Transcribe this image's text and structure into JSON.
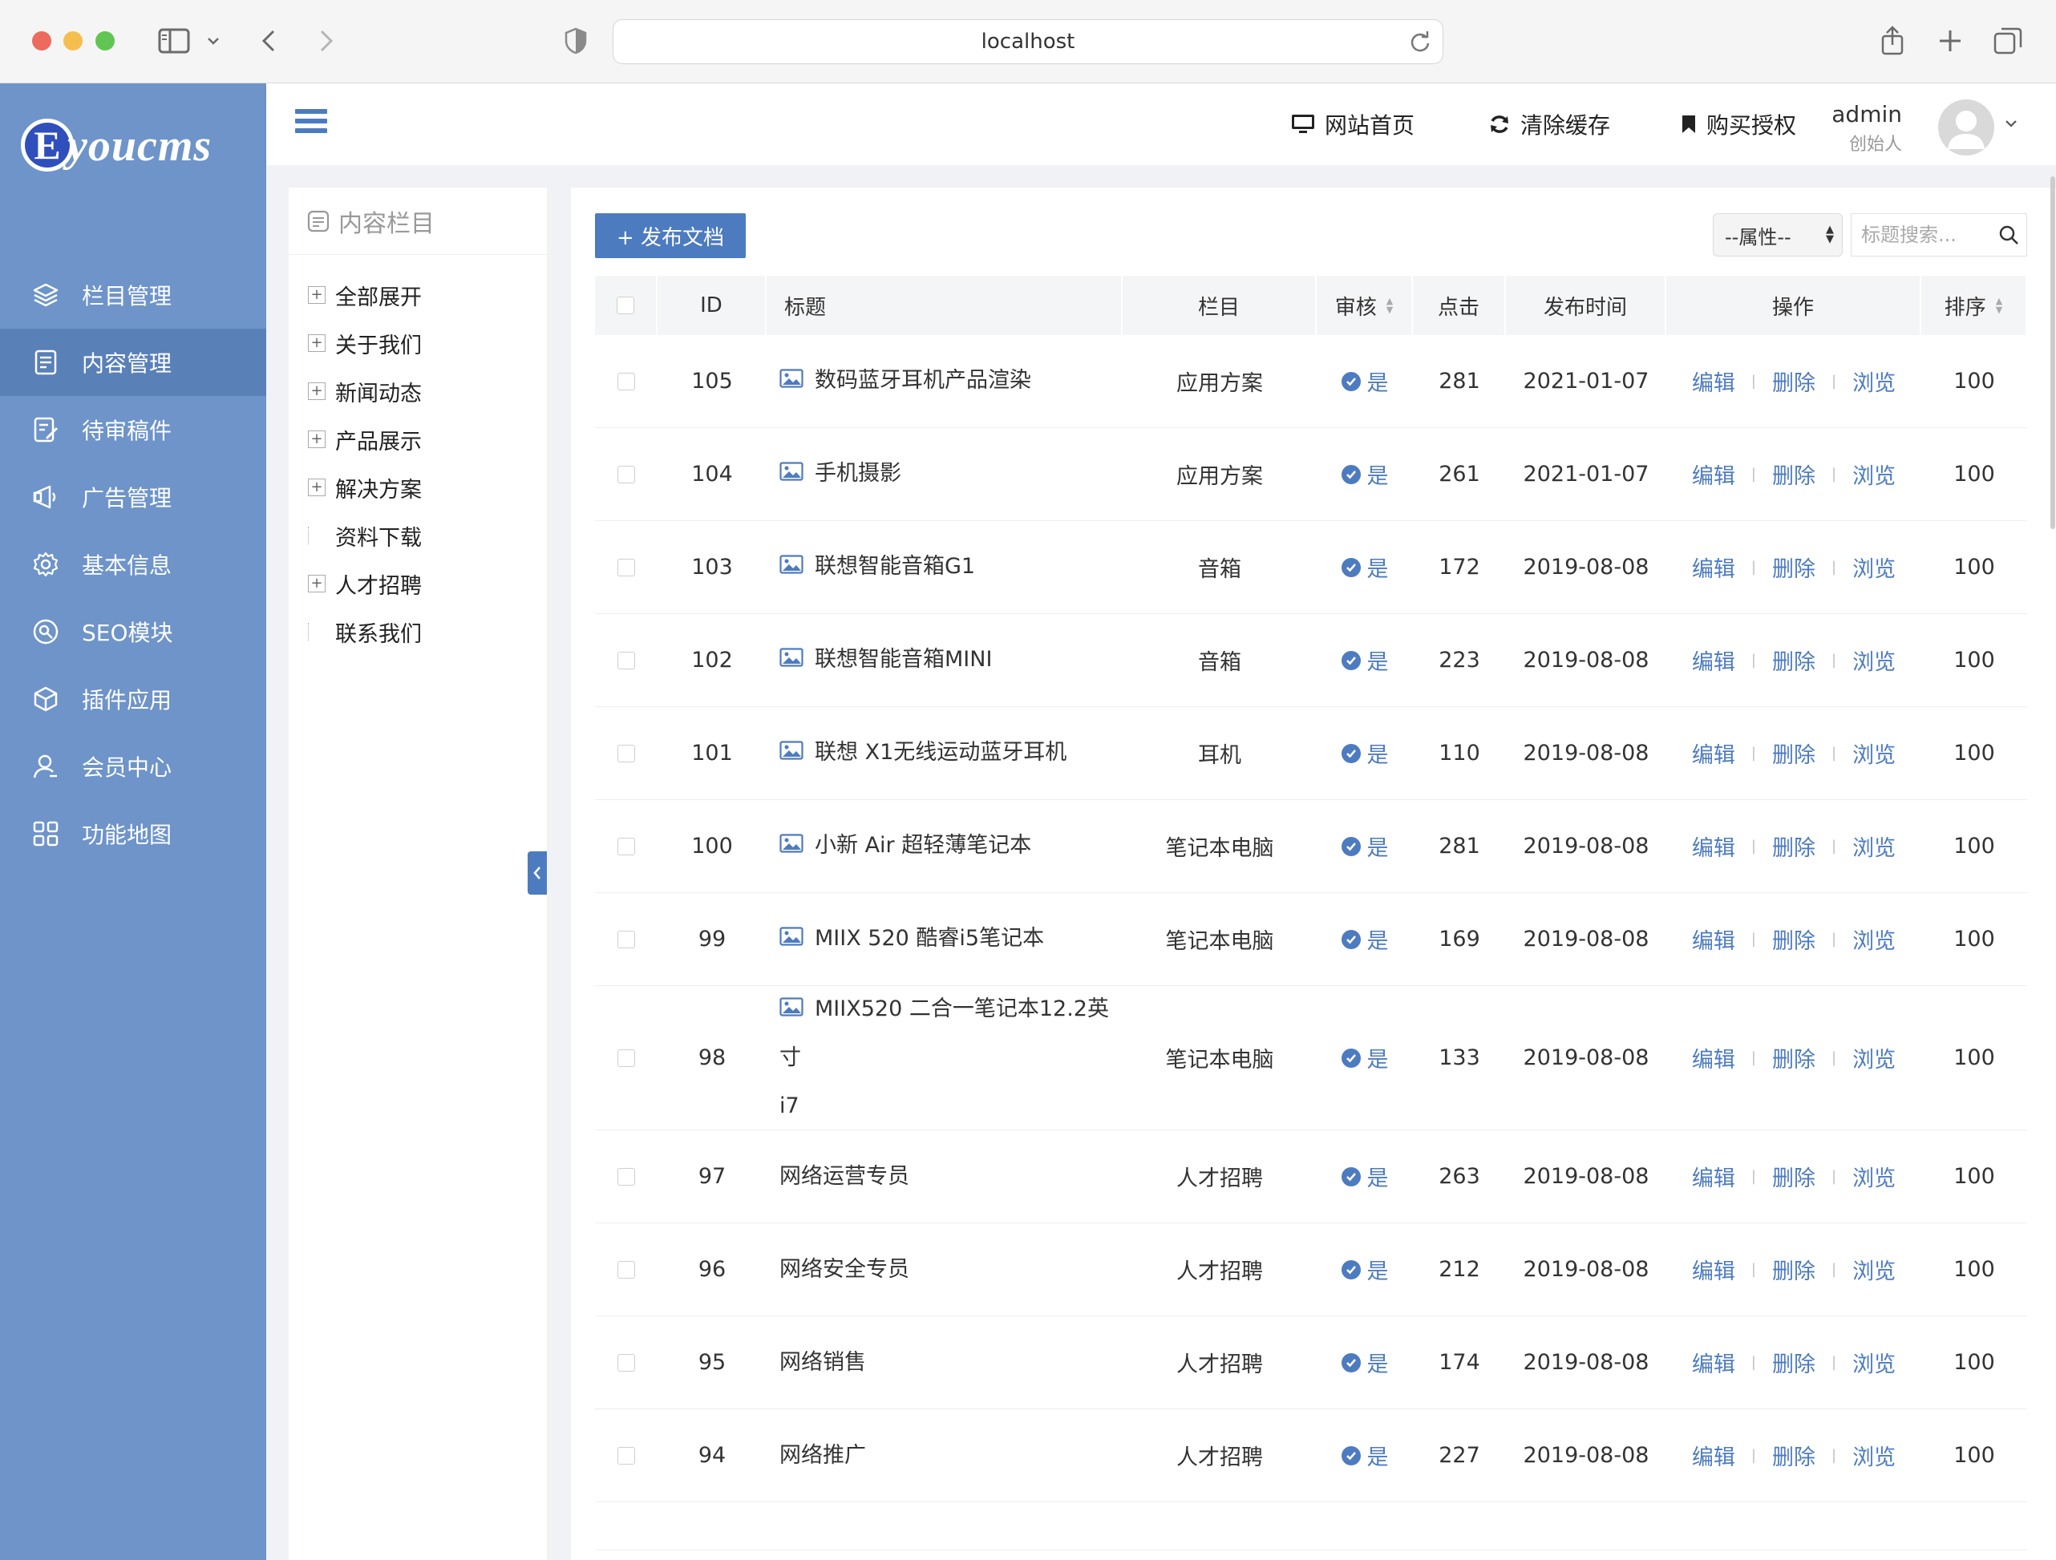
{
  "browser": {
    "url": "localhost"
  },
  "sidebar": {
    "logo_letter": "E",
    "logo_text": "youcms",
    "items": [
      {
        "label": "栏目管理",
        "icon": "layers-icon",
        "active": false
      },
      {
        "label": "内容管理",
        "icon": "document-icon",
        "active": true
      },
      {
        "label": "待审稿件",
        "icon": "edit-doc-icon",
        "active": false
      },
      {
        "label": "广告管理",
        "icon": "ad-icon",
        "active": false
      },
      {
        "label": "基本信息",
        "icon": "gear-icon",
        "active": false
      },
      {
        "label": "SEO模块",
        "icon": "seo-icon",
        "active": false
      },
      {
        "label": "插件应用",
        "icon": "cube-icon",
        "active": false
      },
      {
        "label": "会员中心",
        "icon": "user-icon",
        "active": false
      },
      {
        "label": "功能地图",
        "icon": "grid-icon",
        "active": false
      }
    ]
  },
  "header": {
    "links": [
      {
        "label": "网站首页",
        "icon": "monitor-icon"
      },
      {
        "label": "清除缓存",
        "icon": "refresh-icon"
      },
      {
        "label": "购买授权",
        "icon": "bookmark-icon"
      }
    ],
    "user_name": "admin",
    "user_role": "创始人"
  },
  "tree": {
    "title": "内容栏目",
    "items": [
      {
        "label": "全部展开",
        "toggle": "+"
      },
      {
        "label": "关于我们",
        "toggle": "+"
      },
      {
        "label": "新闻动态",
        "toggle": "+"
      },
      {
        "label": "产品展示",
        "toggle": "+"
      },
      {
        "label": "解决方案",
        "toggle": "+"
      },
      {
        "label": "资料下载",
        "toggle": ""
      },
      {
        "label": "人才招聘",
        "toggle": "+"
      },
      {
        "label": "联系我们",
        "toggle": ""
      }
    ]
  },
  "toolbar": {
    "publish_label": "+ 发布文档",
    "attr_select_value": "--属性--",
    "search_placeholder": "标题搜索..."
  },
  "table": {
    "headers": {
      "id": "ID",
      "title": "标题",
      "column": "栏目",
      "audit": "审核",
      "hits": "点击",
      "date": "发布时间",
      "ops": "操作",
      "sort": "排序"
    },
    "ops": {
      "edit": "编辑",
      "delete": "删除",
      "view": "浏览",
      "sep": "|"
    },
    "rows": [
      {
        "id": "105",
        "title": "数码蓝牙耳机产品渲染",
        "title2": "",
        "has_image": true,
        "column": "应用方案",
        "audit": "是",
        "hits": "281",
        "date": "2021-01-07",
        "sort": "100"
      },
      {
        "id": "104",
        "title": "手机摄影",
        "title2": "",
        "has_image": true,
        "column": "应用方案",
        "audit": "是",
        "hits": "261",
        "date": "2021-01-07",
        "sort": "100"
      },
      {
        "id": "103",
        "title": "联想智能音箱G1",
        "title2": "",
        "has_image": true,
        "column": "音箱",
        "audit": "是",
        "hits": "172",
        "date": "2019-08-08",
        "sort": "100"
      },
      {
        "id": "102",
        "title": "联想智能音箱MINI",
        "title2": "",
        "has_image": true,
        "column": "音箱",
        "audit": "是",
        "hits": "223",
        "date": "2019-08-08",
        "sort": "100"
      },
      {
        "id": "101",
        "title": "联想 X1无线运动蓝牙耳机",
        "title2": "",
        "has_image": true,
        "column": "耳机",
        "audit": "是",
        "hits": "110",
        "date": "2019-08-08",
        "sort": "100"
      },
      {
        "id": "100",
        "title": "小新 Air 超轻薄笔记本",
        "title2": "",
        "has_image": true,
        "column": "笔记本电脑",
        "audit": "是",
        "hits": "281",
        "date": "2019-08-08",
        "sort": "100"
      },
      {
        "id": "99",
        "title": "MIIX 520 酷睿i5笔记本",
        "title2": "",
        "has_image": true,
        "column": "笔记本电脑",
        "audit": "是",
        "hits": "169",
        "date": "2019-08-08",
        "sort": "100"
      },
      {
        "id": "98",
        "title": "MIIX520 二合一笔记本12.2英寸",
        "title2": "i7",
        "has_image": true,
        "column": "笔记本电脑",
        "audit": "是",
        "hits": "133",
        "date": "2019-08-08",
        "sort": "100"
      },
      {
        "id": "97",
        "title": "网络运营专员",
        "title2": "",
        "has_image": false,
        "column": "人才招聘",
        "audit": "是",
        "hits": "263",
        "date": "2019-08-08",
        "sort": "100"
      },
      {
        "id": "96",
        "title": "网络安全专员",
        "title2": "",
        "has_image": false,
        "column": "人才招聘",
        "audit": "是",
        "hits": "212",
        "date": "2019-08-08",
        "sort": "100"
      },
      {
        "id": "95",
        "title": "网络销售",
        "title2": "",
        "has_image": false,
        "column": "人才招聘",
        "audit": "是",
        "hits": "174",
        "date": "2019-08-08",
        "sort": "100"
      },
      {
        "id": "94",
        "title": "网络推广",
        "title2": "",
        "has_image": false,
        "column": "人才招聘",
        "audit": "是",
        "hits": "227",
        "date": "2019-08-08",
        "sort": "100"
      }
    ]
  },
  "colors": {
    "sidebar_bg": "#6e94c9",
    "sidebar_active": "#5a80b8",
    "accent": "#4d7bbf"
  }
}
